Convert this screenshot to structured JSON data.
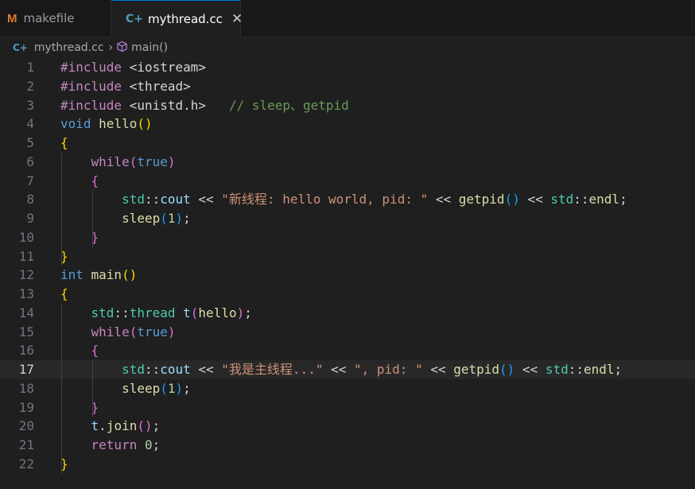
{
  "tabs": [
    {
      "label": "makefile",
      "icon": "makefile-m-icon",
      "active": false
    },
    {
      "label": "mythread.cc",
      "icon": "cpp-file-icon",
      "active": true
    }
  ],
  "breadcrumb": {
    "file": "mythread.cc",
    "symbol": "main()"
  },
  "editor": {
    "current_line": 17,
    "line_numbers": [
      "1",
      "2",
      "3",
      "4",
      "5",
      "6",
      "7",
      "8",
      "9",
      "10",
      "11",
      "12",
      "13",
      "14",
      "15",
      "16",
      "17",
      "18",
      "19",
      "20",
      "21",
      "22"
    ],
    "lines": [
      [
        [
          "pre",
          "#include "
        ],
        [
          "plain",
          "<iostream>"
        ]
      ],
      [
        [
          "pre",
          "#include "
        ],
        [
          "plain",
          "<thread>"
        ]
      ],
      [
        [
          "pre",
          "#include "
        ],
        [
          "plain",
          "<unistd.h>"
        ],
        [
          "plain",
          "   "
        ],
        [
          "cmt",
          "// sleep、getpid"
        ]
      ],
      [
        [
          "blue",
          "void "
        ],
        [
          "fn",
          "hello"
        ],
        [
          "pb1",
          "()"
        ]
      ],
      [
        [
          "pb1",
          "{"
        ]
      ],
      [
        [
          "plain",
          "    "
        ],
        [
          "purple",
          "while"
        ],
        [
          "pb2",
          "("
        ],
        [
          "blue",
          "true"
        ],
        [
          "pb2",
          ")"
        ]
      ],
      [
        [
          "plain",
          "    "
        ],
        [
          "pb2",
          "{"
        ]
      ],
      [
        [
          "plain",
          "        "
        ],
        [
          "ns",
          "std"
        ],
        [
          "plain",
          "::"
        ],
        [
          "var",
          "cout"
        ],
        [
          "plain",
          " << "
        ],
        [
          "str",
          "\"新线程: hello world, pid: \""
        ],
        [
          "plain",
          " << "
        ],
        [
          "fn",
          "getpid"
        ],
        [
          "pb3",
          "()"
        ],
        [
          "plain",
          " << "
        ],
        [
          "ns",
          "std"
        ],
        [
          "plain",
          "::"
        ],
        [
          "fn",
          "endl"
        ],
        [
          "plain",
          ";"
        ]
      ],
      [
        [
          "plain",
          "        "
        ],
        [
          "fn",
          "sleep"
        ],
        [
          "pb3",
          "("
        ],
        [
          "num",
          "1"
        ],
        [
          "pb3",
          ")"
        ],
        [
          "plain",
          ";"
        ]
      ],
      [
        [
          "plain",
          "    "
        ],
        [
          "pb2",
          "}"
        ]
      ],
      [
        [
          "pb1",
          "}"
        ]
      ],
      [
        [
          "blue",
          "int "
        ],
        [
          "fn",
          "main"
        ],
        [
          "pb1",
          "()"
        ]
      ],
      [
        [
          "pb1",
          "{"
        ]
      ],
      [
        [
          "plain",
          "    "
        ],
        [
          "ns",
          "std"
        ],
        [
          "plain",
          "::"
        ],
        [
          "ns",
          "thread"
        ],
        [
          "plain",
          " "
        ],
        [
          "var",
          "t"
        ],
        [
          "pb2",
          "("
        ],
        [
          "fn",
          "hello"
        ],
        [
          "pb2",
          ")"
        ],
        [
          "plain",
          ";"
        ]
      ],
      [
        [
          "plain",
          "    "
        ],
        [
          "purple",
          "while"
        ],
        [
          "pb2",
          "("
        ],
        [
          "blue",
          "true"
        ],
        [
          "pb2",
          ")"
        ]
      ],
      [
        [
          "plain",
          "    "
        ],
        [
          "pb2",
          "{"
        ]
      ],
      [
        [
          "plain",
          "        "
        ],
        [
          "ns",
          "std"
        ],
        [
          "plain",
          "::"
        ],
        [
          "var",
          "cout"
        ],
        [
          "plain",
          " << "
        ],
        [
          "str",
          "\"我是主线程...\""
        ],
        [
          "plain",
          " << "
        ],
        [
          "str",
          "\", pid: \""
        ],
        [
          "plain",
          " << "
        ],
        [
          "fn",
          "getpid"
        ],
        [
          "pb3",
          "()"
        ],
        [
          "plain",
          " << "
        ],
        [
          "ns",
          "std"
        ],
        [
          "plain",
          "::"
        ],
        [
          "fn",
          "endl"
        ],
        [
          "plain",
          ";"
        ]
      ],
      [
        [
          "plain",
          "        "
        ],
        [
          "fn",
          "sleep"
        ],
        [
          "pb3",
          "("
        ],
        [
          "num",
          "1"
        ],
        [
          "pb3",
          ")"
        ],
        [
          "plain",
          ";"
        ]
      ],
      [
        [
          "plain",
          "    "
        ],
        [
          "pb2",
          "}"
        ]
      ],
      [
        [
          "plain",
          "    "
        ],
        [
          "var",
          "t"
        ],
        [
          "plain",
          "."
        ],
        [
          "fn",
          "join"
        ],
        [
          "pb2",
          "()"
        ],
        [
          "plain",
          ";"
        ]
      ],
      [
        [
          "plain",
          "    "
        ],
        [
          "purple",
          "return"
        ],
        [
          "plain",
          " "
        ],
        [
          "num",
          "0"
        ],
        [
          "plain",
          ";"
        ]
      ],
      [
        [
          "pb1",
          "}"
        ]
      ]
    ]
  }
}
